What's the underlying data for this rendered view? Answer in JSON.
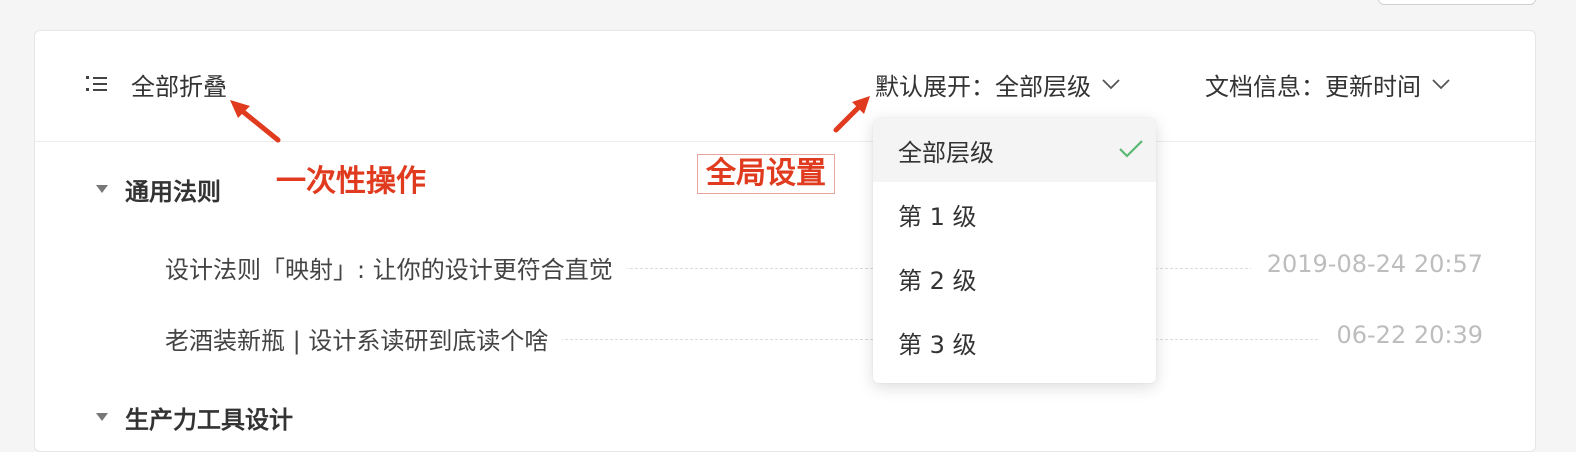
{
  "toolbar": {
    "collapse_all_label": "全部折叠",
    "default_expand_label": "默认展开：全部层级",
    "doc_info_label": "文档信息：更新时间"
  },
  "dropdown": {
    "options": [
      {
        "label": "全部层级",
        "selected": true
      },
      {
        "label": "第 1 级",
        "selected": false
      },
      {
        "label": "第 2 级",
        "selected": false
      },
      {
        "label": "第 3 级",
        "selected": false
      }
    ]
  },
  "sections": [
    {
      "title": "通用法则",
      "docs": [
        {
          "title": "设计法则「映射」: 让你的设计更符合直觉",
          "date": "2019-08-24 20:57"
        },
        {
          "title": "老酒装新瓶 | 设计系读研到底读个啥",
          "date": "06-22 20:39"
        }
      ]
    },
    {
      "title": "生产力工具设计",
      "docs": []
    }
  ],
  "annotations": {
    "one_time_op": "一次性操作",
    "global_setting": "全局设置"
  },
  "colors": {
    "annotation_red": "#e03a1f",
    "check_green": "#5bb974"
  },
  "icons": {
    "collapse": "list-collapse-icon",
    "chevron": "chevron-down-icon",
    "check": "check-icon",
    "triangle": "caret-down-icon"
  }
}
